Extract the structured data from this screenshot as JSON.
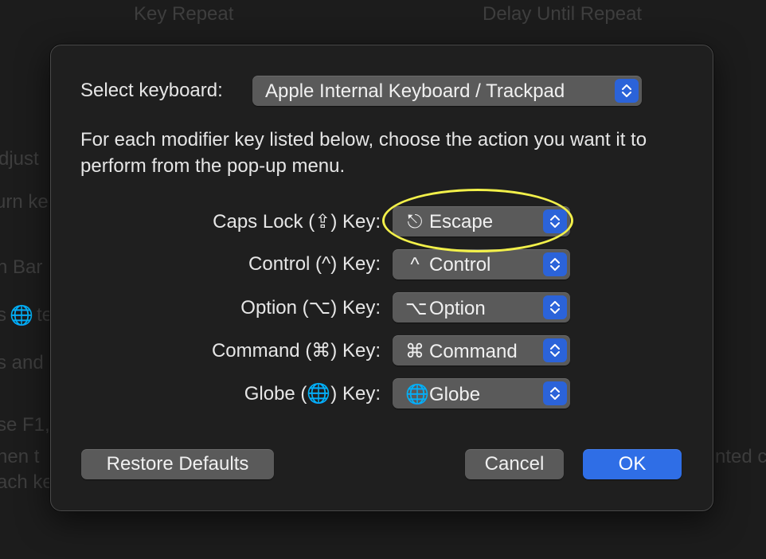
{
  "background": {
    "key_repeat": "Key Repeat",
    "delay_until_repeat": "Delay Until Repeat",
    "line1": "djust",
    "line2": "urn ke",
    "line3": "n Bar",
    "line4": "s",
    "line4b": "te",
    "line5": "s and",
    "line6": "se F1,",
    "line7": "hen t",
    "line8": "ach ke",
    "right_text": "nted c"
  },
  "dialog": {
    "select_keyboard_label": "Select keyboard:",
    "keyboard_value": "Apple Internal Keyboard / Trackpad",
    "description": "For each modifier key listed below, choose the action you want it to perform from the pop-up menu.",
    "rows": [
      {
        "label": "Caps Lock (⇪) Key:",
        "glyph": "⎋",
        "value": "Escape",
        "icon": "escape-icon"
      },
      {
        "label": "Control (^) Key:",
        "glyph": "^",
        "value": "Control",
        "icon": "control-icon"
      },
      {
        "label": "Option (⌥) Key:",
        "glyph": "⌥",
        "value": "Option",
        "icon": "option-icon"
      },
      {
        "label": "Command (⌘) Key:",
        "glyph": "⌘",
        "value": "Command",
        "icon": "command-icon"
      },
      {
        "label": "Globe (🌐) Key:",
        "glyph": "🌐",
        "value": "Globe",
        "icon": "globe-icon"
      }
    ],
    "restore_defaults": "Restore Defaults",
    "cancel": "Cancel",
    "ok": "OK"
  },
  "colors": {
    "accent": "#2f6ee6",
    "highlight": "#f2f04a"
  }
}
